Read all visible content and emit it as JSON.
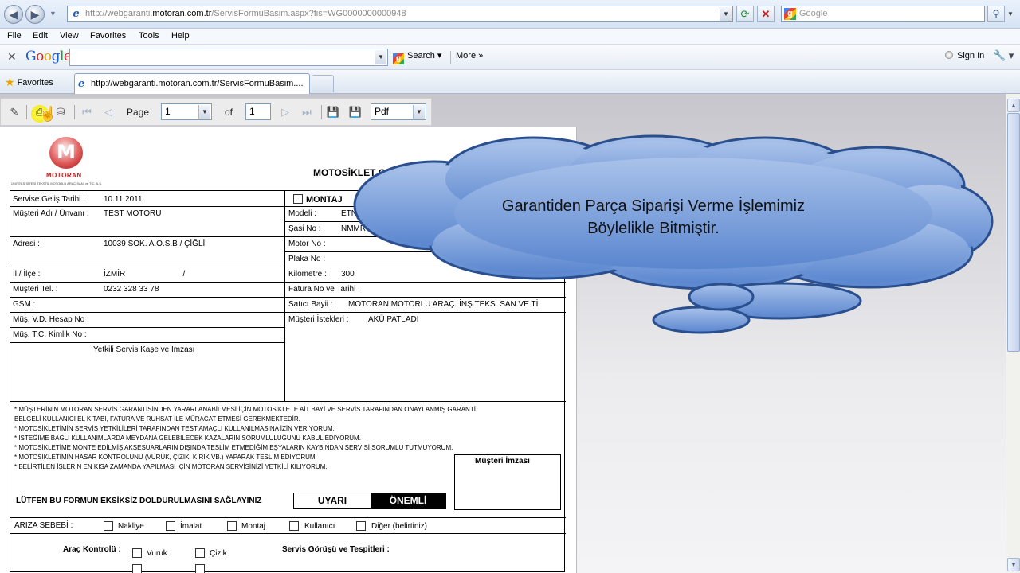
{
  "browser": {
    "url_prefix": "http://webgaranti.",
    "url_domain": "motoran.com.tr",
    "url_suffix": "/ServisFormuBasim.aspx?fis=WG0000000000948",
    "search_placeholder": "Google",
    "menu": [
      "File",
      "Edit",
      "View",
      "Favorites",
      "Tools",
      "Help"
    ],
    "google_toolbar": {
      "search_label": "Search",
      "more_label": "More »",
      "signin_label": "Sign In"
    },
    "favorites_label": "Favorites",
    "tab_title": "http://webgaranti.motoran.com.tr/ServisFormuBasim...."
  },
  "viewer": {
    "page_label": "Page",
    "page_value": "1",
    "of_label": "of",
    "total_pages": "1",
    "format_value": "Pdf"
  },
  "report": {
    "logo_name": "MOTORAN",
    "logo_subtitle": "ÜNİTEKS SİTESİ TEKSTİL MOTORLU ARAÇ SAN. ve TİC. A.Ş.",
    "title": "MOTOSİKLET GAR",
    "left_rows": [
      {
        "label": "Servise Geliş Tarihi :",
        "value": "10.11.2011"
      },
      {
        "label": "Müşteri Adı / Ünvanı :",
        "value": "TEST MOTORU"
      },
      {
        "label": "Adresi :",
        "value": "10039 SOK. A.O.S.B / ÇİĞLİ"
      },
      {
        "label": "İl / İlçe :",
        "value": "İZMİR                          /"
      },
      {
        "label": "Müşteri Tel. :",
        "value": "0232 328 33 78"
      },
      {
        "label": "GSM :",
        "value": ""
      },
      {
        "label": "Müş. V.D. Hesap No :",
        "value": ""
      },
      {
        "label": "Müş. T.C. Kimlik No :",
        "value": ""
      }
    ],
    "stamp_label": "Yetkili Servis Kaşe ve İmzası",
    "montaj_label": "MONTAJ",
    "right_rows": [
      {
        "label": "Modeli :",
        "value": "ETNA"
      },
      {
        "label": "Şasi No :",
        "value": "NMMR"
      },
      {
        "label": "Motor No :",
        "value": ""
      },
      {
        "label": "Plaka No :",
        "value": ""
      },
      {
        "label": "Kilometre :",
        "value": "300"
      },
      {
        "label": "Fatura No ve Tarihi :",
        "value": ""
      },
      {
        "label": "Satıcı Bayii :",
        "value": "MOTORAN MOTORLU ARAÇ. İNŞ.TEKS. SAN.VE Tİ"
      },
      {
        "label": "Müşteri İstekleri :",
        "value": "AKÜ PATLADI"
      }
    ],
    "notes": [
      "* MÜŞTERİNİN MOTORAN SERVİS GARANTİSİNDEN YARARLANABİLMESİ İÇİN MOTOSİKLETE AİT BAYİ VE SERVİS TARAFINDAN ONAYLANMIŞ GARANTİ",
      "BELGELİ KULLANICI EL KİTABI, FATURA VE RUHSAT İLE MÜRACAT ETMESİ GEREKMEKTEDİR.",
      "* MOTOSİKLETİMİN SERVİS YETKİLİLERİ TARAFINDAN TEST AMAÇLI KULLANILMASINA İZİN VERİYORUM.",
      "* İSTEĞİME BAĞLI KULLANIMLARDA MEYDANA GELEBİLECEK KAZALARIN SORUMLULUĞUNU KABUL EDİYORUM.",
      "* MOTOSİKLETİME MONTE EDİLMİŞ AKSESUARLARIN DIŞINDA TESLİM ETMEDİĞİM EŞYALARIN KAYBINDAN SERVİSİ SORUMLU TUTMUYORUM.",
      "* MOTOSİKLETİMİN HASAR KONTROLÜNÜ (VURUK, ÇİZİK, KIRIK VB.) YAPARAK TESLİM EDİYORUM.",
      "* BELİRTİLEN İŞLERİN EN KISA ZAMANDA YAPILMASI İÇİN MOTORAN SERVİSİNİZİ YETKİLİ KILIYORUM."
    ],
    "signature_label": "Müşteri İmzası",
    "warning_text": "LÜTFEN BU FORMUN EKSİKSİZ DOLDURULMASINI SAĞLAYINIZ",
    "uyari_label": "UYARI",
    "onemli_label": "ÖNEMLİ",
    "fault_label": "ARIZA SEBEBİ :",
    "fault_options": [
      "Nakliye",
      "İmalat",
      "Montaj",
      "Kullanıcı",
      "Diğer (belirtiniz)"
    ],
    "vehicle_control_label": "Araç Kontrolü :",
    "vehicle_options": [
      "Vuruk",
      "Çizik"
    ],
    "service_opinion_label": "Servis Görüşü ve Tespitleri :"
  },
  "callout": {
    "line1": "Garantiden Parça Siparişi Verme İşlemimiz",
    "line2": "Böylelikle Bitmiştir."
  }
}
